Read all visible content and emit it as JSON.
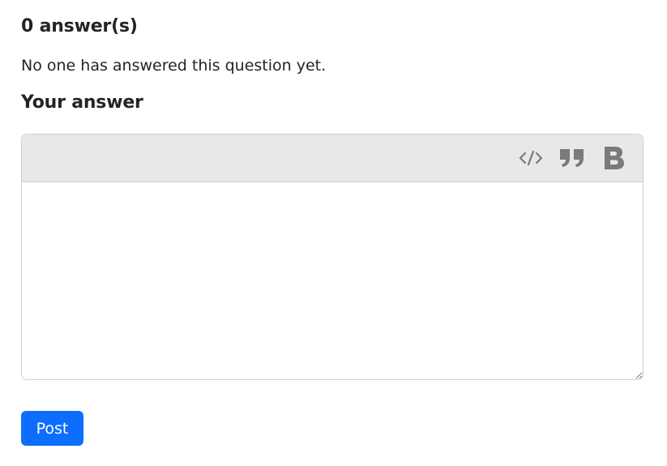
{
  "answers": {
    "title": "0 answer(s)",
    "empty_message": "No one has answered this question yet."
  },
  "your_answer": {
    "title": "Your answer"
  },
  "editor": {
    "toolbar": [
      {
        "icon": "code-icon",
        "action": "code"
      },
      {
        "icon": "quote-icon",
        "action": "quote"
      },
      {
        "icon": "bold-icon",
        "action": "bold"
      }
    ],
    "text": "",
    "icon_color": "#7a7a7a"
  },
  "post_button": {
    "label": "Post",
    "color": "#0d6efd"
  }
}
